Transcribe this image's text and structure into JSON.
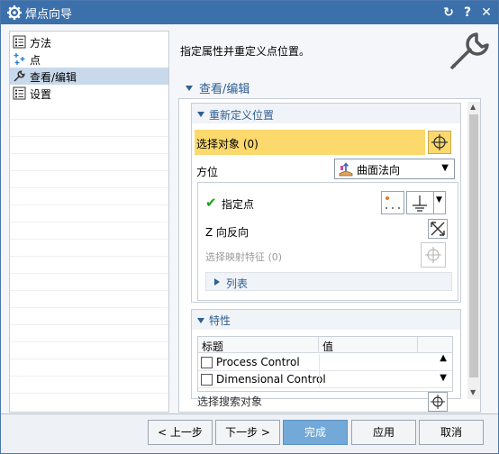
{
  "window": {
    "title": "焊点向导",
    "icons": [
      "gear-icon",
      "reset-icon",
      "help-icon",
      "close-icon"
    ],
    "reset_glyph": "↻",
    "help_glyph": "?",
    "close_glyph": "✕"
  },
  "nav": {
    "items": [
      {
        "label": "方法",
        "icon": "list-icon",
        "selected": false
      },
      {
        "label": "点",
        "icon": "points-icon",
        "selected": false
      },
      {
        "label": "查看/编辑",
        "icon": "wrench-icon",
        "selected": true
      },
      {
        "label": "设置",
        "icon": "list-icon",
        "selected": false
      }
    ]
  },
  "instruction": "指定属性并重定义点位置。",
  "section": {
    "title": "查看/编辑",
    "redefine": {
      "title": "重新定义位置",
      "select_object": "选择对象 (0)",
      "orientation_label": "方位",
      "orientation_value": "曲面法向",
      "specify_point": "指定点",
      "z_reverse": "Z 向反向",
      "select_map_feature": "选择映射特征 (0)",
      "list": "列表"
    },
    "properties": {
      "title": "特性",
      "columns": [
        "标题",
        "值"
      ],
      "rows": [
        {
          "title": "Process Control",
          "value": ""
        },
        {
          "title": "Dimensional Control",
          "value": ""
        }
      ],
      "partial_row": "选择搜索对象"
    }
  },
  "buttons": {
    "prev": "< 上一步",
    "next": "下一步 >",
    "finish": "完成",
    "apply": "应用",
    "cancel": "取消"
  },
  "colors": {
    "titlebar": "#3b70ab",
    "selection_highlight": "#fbd96d",
    "accent": "#2f5e93",
    "finish_button": "#73a9d8"
  }
}
